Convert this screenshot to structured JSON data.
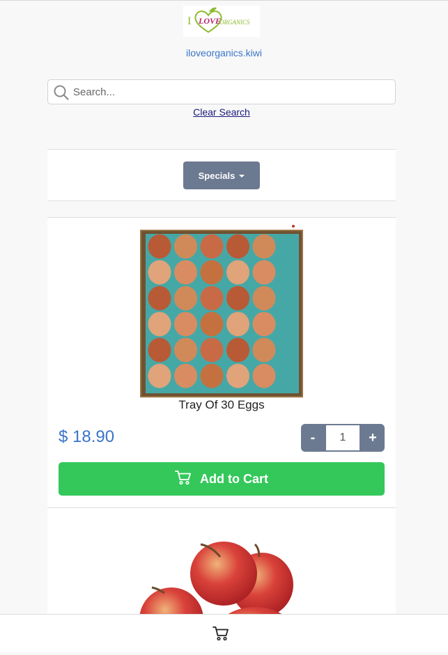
{
  "header": {
    "logo_text_i": "I",
    "logo_text_love": "LOVE",
    "logo_text_organics": "ORGANICS",
    "site_link": "iloveorganics.kiwi"
  },
  "search": {
    "placeholder": "Search...",
    "value": "",
    "clear_label": "Clear Search"
  },
  "category": {
    "selected": "Specials"
  },
  "products": [
    {
      "name": "Tray Of 30 Eggs",
      "price": "$ 18.90",
      "quantity": "1",
      "minus_label": "-",
      "plus_label": "+",
      "add_label": "Add to Cart"
    }
  ],
  "icons": {
    "search": "search-icon",
    "cart": "cart-icon",
    "caret": "caret-down-icon"
  },
  "colors": {
    "accent_blue": "#3a74c9",
    "button_grey": "#6c7a91",
    "add_green": "#34c85a"
  }
}
